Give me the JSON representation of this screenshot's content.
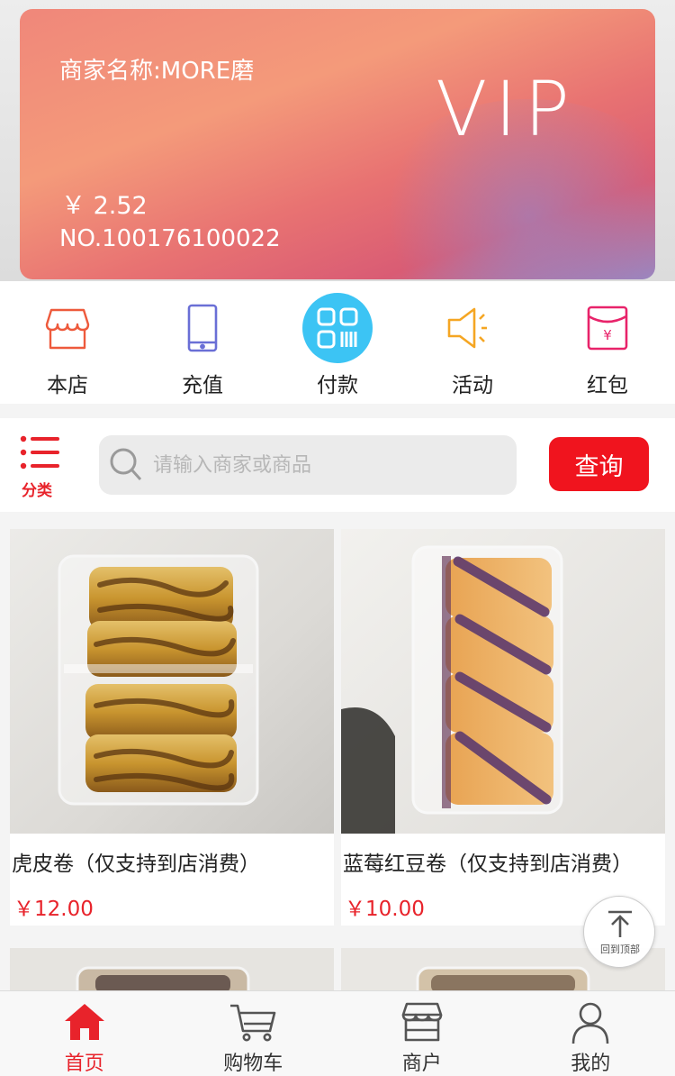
{
  "vip_card": {
    "merchant_label": "商家名称:MORE磨",
    "badge": "VIP",
    "balance": "￥ 2.52",
    "card_no": "NO.100176100022"
  },
  "quick_menu": [
    {
      "label": "本店",
      "icon": "storefront-icon",
      "color": "#ee5a3c"
    },
    {
      "label": "充值",
      "icon": "phone-icon",
      "color": "#6a6fd6"
    },
    {
      "label": "付款",
      "icon": "qr-scan-icon",
      "color": "#3cc4f4"
    },
    {
      "label": "活动",
      "icon": "megaphone-icon",
      "color": "#f5a623"
    },
    {
      "label": "红包",
      "icon": "red-envelope-icon",
      "color": "#e8236a"
    }
  ],
  "search": {
    "category_label": "分类",
    "placeholder": "请输入商家或商品",
    "button_label": "查询"
  },
  "products": [
    {
      "name": "虎皮卷（仅支持到店消费）",
      "price": "￥12.00"
    },
    {
      "name": "蓝莓红豆卷（仅支持到店消费）",
      "price": "￥10.00"
    }
  ],
  "back_to_top_label": "回到顶部",
  "tabbar": [
    {
      "label": "首页",
      "icon": "home-icon",
      "active": true
    },
    {
      "label": "购物车",
      "icon": "cart-icon",
      "active": false
    },
    {
      "label": "商户",
      "icon": "shop-icon",
      "active": false
    },
    {
      "label": "我的",
      "icon": "user-icon",
      "active": false
    }
  ],
  "colors": {
    "accent": "#e8232b",
    "pay": "#3cc4f4"
  }
}
